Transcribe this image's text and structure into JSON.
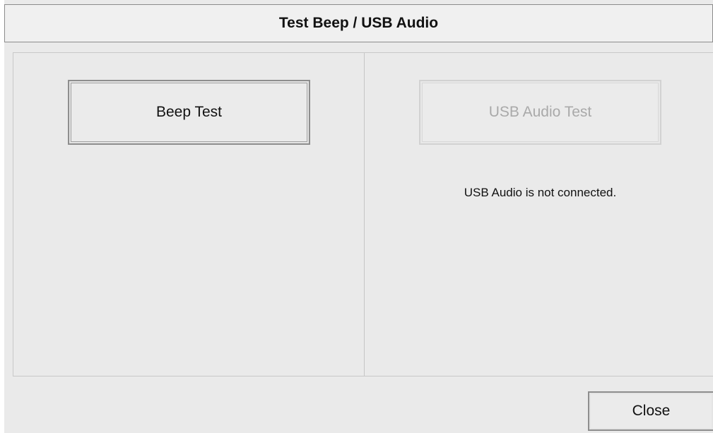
{
  "dialog": {
    "title": "Test Beep / USB Audio"
  },
  "beep_panel": {
    "button_label": "Beep Test",
    "button_enabled": true
  },
  "usb_panel": {
    "button_label": "USB Audio Test",
    "button_enabled": false,
    "status_text": "USB Audio is not connected."
  },
  "footer": {
    "close_label": "Close"
  },
  "colors": {
    "background": "#eaeaea",
    "disabled_text": "#a9a9a9",
    "border": "#8e8e8e"
  }
}
